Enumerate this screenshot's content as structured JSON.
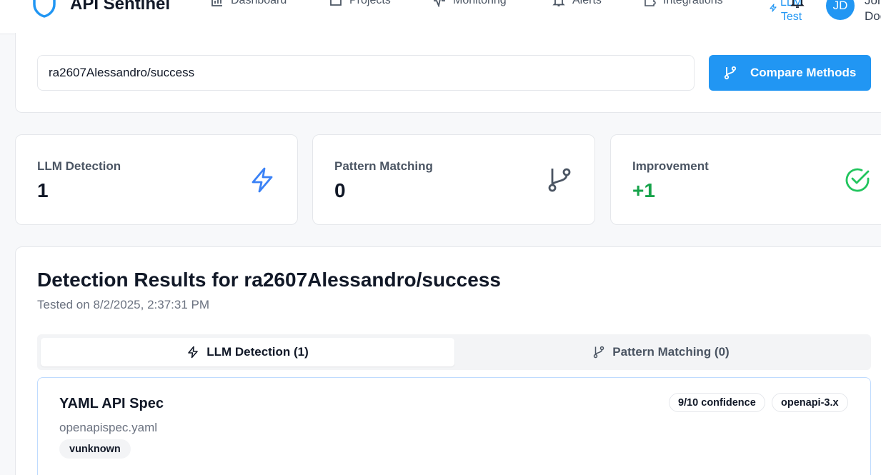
{
  "header": {
    "brand": "API Sentinel",
    "nav": [
      {
        "label": "Dashboard",
        "icon": "bar-chart-icon"
      },
      {
        "label": "Projects",
        "icon": "folder-icon"
      },
      {
        "label": "Monitoring",
        "icon": "activity-icon"
      },
      {
        "label": "Alerts",
        "icon": "bell-icon"
      },
      {
        "label": "Integrations",
        "icon": "puzzle-icon"
      }
    ],
    "active_nav": {
      "label": "LLM Test",
      "icon": "zap-icon"
    },
    "user": {
      "initials": "JD",
      "name": "John Doe"
    }
  },
  "search": {
    "value": "ra2607Alessandro/success",
    "button_label": "Compare Methods"
  },
  "stats": [
    {
      "label": "LLM Detection",
      "value": "1",
      "icon": "zap-icon",
      "color": "#3b82f6"
    },
    {
      "label": "Pattern Matching",
      "value": "0",
      "icon": "git-branch-icon",
      "color": "#4b5563"
    },
    {
      "label": "Improvement",
      "value": "+1",
      "icon": "check-circle-icon",
      "color": "#16a34a"
    }
  ],
  "results": {
    "title": "Detection Results for ra2607Alessandro/success",
    "tested_on": "Tested on 8/2/2025, 2:37:31 PM",
    "tabs": [
      {
        "label": "LLM Detection (1)",
        "active": true
      },
      {
        "label": "Pattern Matching (0)",
        "active": false
      }
    ],
    "items": [
      {
        "title": "YAML API Spec",
        "file": "openapispec.yaml",
        "confidence": "9/10 confidence",
        "format": "openapi-3.x",
        "version": "vunknown"
      }
    ]
  },
  "colors": {
    "accent": "#2196f3",
    "success": "#16a34a",
    "background": "#f7f8fa"
  }
}
